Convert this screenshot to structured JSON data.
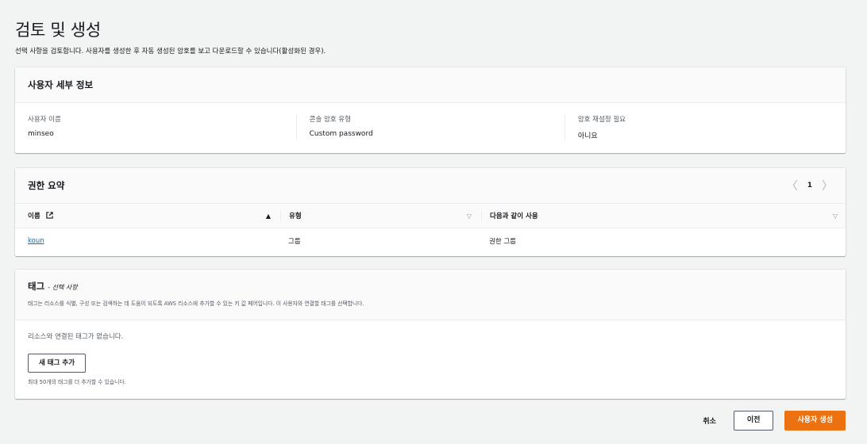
{
  "page": {
    "title": "검토 및 생성",
    "description": "선택 사항을 검토합니다. 사용자를 생성한 후 자동 생성된 암호를 보고 다운로드할 수 있습니다(활성화된 경우)."
  },
  "user_details": {
    "title": "사용자 세부 정보",
    "fields": [
      {
        "label": "사용자 이름",
        "value": "minseo"
      },
      {
        "label": "콘솔 암호 유형",
        "value": "Custom password"
      },
      {
        "label": "암호 재설정 필요",
        "value": "아니요"
      }
    ]
  },
  "permissions": {
    "title": "권한 요약",
    "page_number": "1",
    "columns": [
      "이름",
      "유형",
      "다음과 같이 사용"
    ],
    "rows": [
      {
        "name": "koun",
        "type": "그룹",
        "used_as": "권한 그룹"
      }
    ]
  },
  "tags": {
    "title": "태그",
    "optional": "- 선택 사항",
    "description": "태그는 리소스를 식별, 구성 또는 검색하는 데 도움이 되도록 AWS 리소스에 추가할 수 있는 키 값 페어입니다. 이 사용자와 연결할 태그를 선택합니다.",
    "empty_text": "리소스와 연결된 태그가 없습니다.",
    "add_button": "새 태그 추가",
    "hint": "최대 50개의 태그를 더 추가할 수 있습니다."
  },
  "footer": {
    "cancel": "취소",
    "previous": "이전",
    "create": "사용자 생성"
  },
  "colors": {
    "primary": "#ec7211",
    "link": "#0073bb",
    "background": "#f2f3f3"
  }
}
